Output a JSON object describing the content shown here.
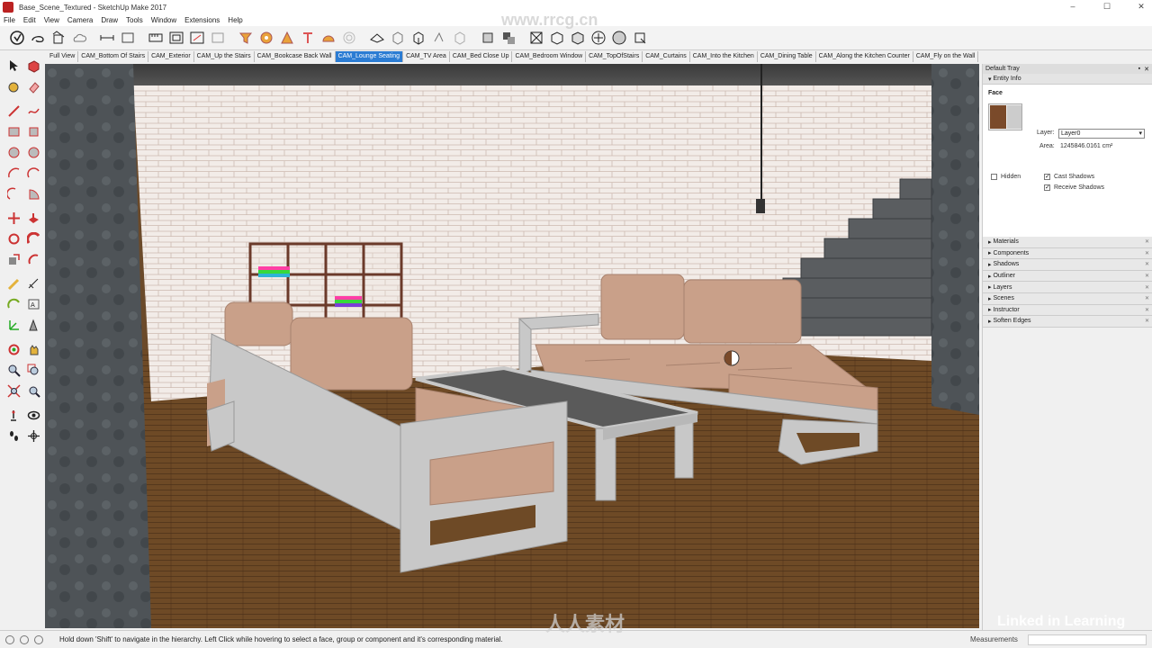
{
  "window": {
    "title": "Base_Scene_Textured - SketchUp Make 2017"
  },
  "menu": [
    "File",
    "Edit",
    "View",
    "Camera",
    "Draw",
    "Tools",
    "Window",
    "Extensions",
    "Help"
  ],
  "toolbar_icons": [
    "select-icon",
    "lasso-icon",
    "paint-bucket-icon",
    "cloud-icon",
    "dimension-icon",
    "section-icon",
    "ruler-icon",
    "protractor-icon",
    "axes-icon",
    "text-icon",
    "walk-icon",
    "tape-icon",
    "orbit-icon",
    "pan-icon",
    "zoom-icon",
    "zoom-extents-icon",
    "iso-view-icon",
    "top-view-icon",
    "front-view-icon",
    "right-view-icon",
    "back-view-icon",
    "left-view-icon",
    "xray-icon",
    "wireframe-icon",
    "hidden-line-icon",
    "shaded-icon",
    "textured-icon",
    "monochrome-icon",
    "warehouse-icon",
    "extension-icon"
  ],
  "scene_tabs": [
    "Full View",
    "CAM_Bottom Of Stairs",
    "CAM_Exterior",
    "CAM_Up the Stairs",
    "CAM_Bookcase Back Wall",
    "CAM_Lounge Seating",
    "CAM_TV Area",
    "CAM_Bed Close Up",
    "CAM_Bedroom Window",
    "CAM_TopOfStairs",
    "CAM_Curtains",
    "CAM_Into the Kitchen",
    "CAM_Dining Table",
    "CAM_Along the Kitchen Counter",
    "CAM_Fly on the Wall"
  ],
  "active_scene": "CAM_Lounge Seating",
  "watermark_top": "www.rrcg.cn",
  "watermark_bottom": "人人素材",
  "tray": {
    "title": "Default Tray",
    "entity_info": {
      "header": "Entity Info",
      "entity_type": "Face",
      "layer_label": "Layer:",
      "layer_value": "Layer0",
      "area_label": "Area:",
      "area_value": "1245846.0161 cm²",
      "hidden_label": "Hidden",
      "cast_shadows_label": "Cast Shadows",
      "receive_shadows_label": "Receive Shadows"
    },
    "sections": [
      "Materials",
      "Components",
      "Shadows",
      "Outliner",
      "Layers",
      "Scenes",
      "Instructor",
      "Soften Edges"
    ]
  },
  "status": {
    "message": "Hold down 'Shift' to navigate in the hierarchy. Left Click while hovering to select a face, group or component and it's corresponding material.",
    "measurements_label": "Measurements"
  },
  "brand_watermark": "Linked in Learning",
  "colors": {
    "active_tab": "#2b7cd3",
    "wood_floor": "#6b4a2a",
    "cushion": "#c9a089",
    "frame": "#c8c8c8"
  }
}
